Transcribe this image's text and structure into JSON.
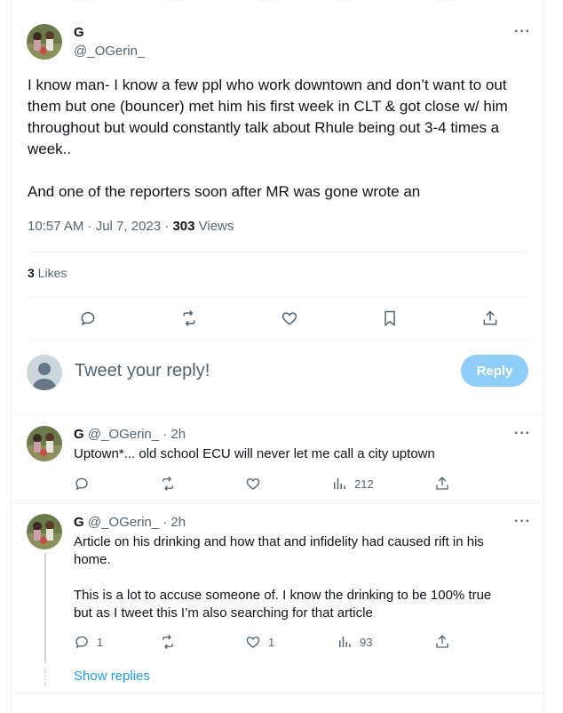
{
  "main_tweet": {
    "display_name": "G",
    "handle": "@_OGerin_",
    "text_p1": "I know man- I know a few ppl who work downtown and don’t want to out them but one (bouncer) met him his first week in CLT   & got close w/ him throughout but would constantly talk about Rhule being out 3-4 times a week..",
    "text_p2": "And one of the reporters soon after MR was gone wrote an",
    "timestamp": "10:57 AM · Jul 7, 2023 · ",
    "views_count": "303",
    "views_label": " Views",
    "likes_count": "3",
    "likes_label": " Likes"
  },
  "reply_box": {
    "placeholder": "Tweet your reply!",
    "button_label": "Reply"
  },
  "replies": [
    {
      "display_name": "G",
      "handle_time": "@_OGerin_ · 2h",
      "text": "Uptown*... old school ECU will never let me call a city uptown",
      "views": "212"
    },
    {
      "display_name": "G",
      "handle_time": "@_OGerin_ · 2h",
      "text_p1": "Article on his drinking and how that and infidelity had caused rift in his home.",
      "text_p2": "This is a lot to accuse someone of. I know the drinking to be 100% true but as I tweet this I’m also searching for that article",
      "reply_count": "1",
      "like_count": "1",
      "views": "93"
    }
  ],
  "show_replies_label": "Show replies",
  "colors": {
    "accent": "#1d9bf0",
    "reply_button": "#8ecdf8",
    "muted_text": "#536471",
    "divider": "#eff3f4"
  }
}
